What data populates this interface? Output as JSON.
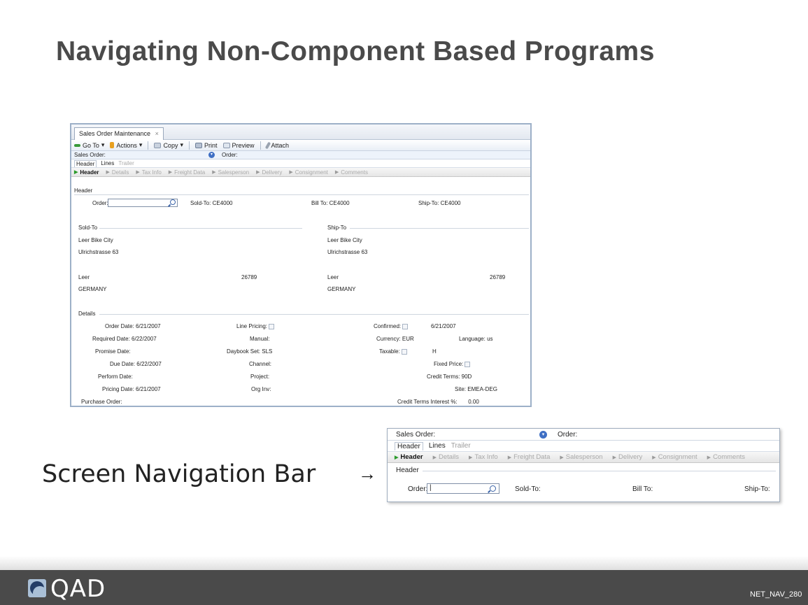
{
  "slide": {
    "title": "Navigating Non-Component Based Programs",
    "label": "Screen Navigation Bar",
    "arrow": "→",
    "footer_logo": "QAD",
    "slide_id": "NET_NAV_280"
  },
  "app": {
    "tab_title": "Sales Order Maintenance",
    "tab_close": "×",
    "toolbar": {
      "goto": "Go To",
      "actions": "Actions",
      "copy": "Copy",
      "print": "Print",
      "preview": "Preview",
      "attach": "Attach",
      "caret": "▾"
    },
    "sales_order_label": "Sales Order:",
    "order_label": "Order:",
    "subtabs": [
      "Header",
      "Lines",
      "Trailer"
    ],
    "nav": [
      "Header",
      "Details",
      "Tax Info",
      "Freight Data",
      "Salesperson",
      "Delivery",
      "Consignment",
      "Comments"
    ],
    "header_section": "Header",
    "order_field_label": "Order:",
    "sold_to_label": "Sold-To:",
    "sold_to_value": "CE4000",
    "bill_to_label": "Bill To:",
    "bill_to_value": "CE4000",
    "ship_to_label": "Ship-To:",
    "ship_to_value": "CE4000",
    "sold_to": {
      "title": "Sold-To",
      "name": "Leer Bike City",
      "street": "Ulrichstrasse 63",
      "city": "Leer",
      "zip": "26789",
      "country": "GERMANY"
    },
    "ship_to": {
      "title": "Ship-To",
      "name": "Leer Bike City",
      "street": "Ulrichstrasse 63",
      "city": "Leer",
      "zip": "26789",
      "country": "GERMANY"
    },
    "details": {
      "title": "Details",
      "order_date_label": "Order Date:",
      "order_date": "6/21/2007",
      "required_date_label": "Required Date:",
      "required_date": "6/22/2007",
      "promise_date_label": "Promise Date:",
      "due_date_label": "Due Date:",
      "due_date": "6/22/2007",
      "perform_date_label": "Perform Date:",
      "pricing_date_label": "Pricing Date:",
      "pricing_date": "6/21/2007",
      "purchase_order_label": "Purchase Order:",
      "line_pricing_label": "Line Pricing:",
      "manual_label": "Manual:",
      "daybook_label": "Daybook Set:",
      "daybook_value": "SLS",
      "channel_label": "Channel:",
      "project_label": "Project:",
      "org_inv_label": "Org Inv:",
      "confirmed_label": "Confirmed:",
      "confirmed_date": "6/21/2007",
      "currency_label": "Currency:",
      "currency_value": "EUR",
      "language_label": "Language:",
      "language_value": "us",
      "taxable_label": "Taxable:",
      "taxable_extra": "H",
      "fixed_price_label": "Fixed Price:",
      "credit_terms_label": "Credit Terms:",
      "credit_terms_value": "90D",
      "site_label": "Site:",
      "site_value": "EMEA-DEG",
      "credit_interest_label": "Credit Terms Interest %:",
      "credit_interest_value": "0.00"
    }
  },
  "zoom": {
    "sales_order_label": "Sales Order:",
    "order_label": "Order:",
    "subtabs": [
      "Header",
      "Lines",
      "Trailer"
    ],
    "nav": [
      "Header",
      "Details",
      "Tax Info",
      "Freight Data",
      "Salesperson",
      "Delivery",
      "Consignment",
      "Comments"
    ],
    "header_section": "Header",
    "order_field_label": "Order:",
    "order_value": "|",
    "sold_to_label": "Sold-To:",
    "bill_to_label": "Bill To:",
    "ship_to_label": "Ship-To:"
  },
  "colors": {
    "title_text": "#4a4a4a",
    "active_nav_triangle": "#2a9a2a",
    "dropdown_blue": "#3f6fc4",
    "footer": "#4a4a4a"
  }
}
